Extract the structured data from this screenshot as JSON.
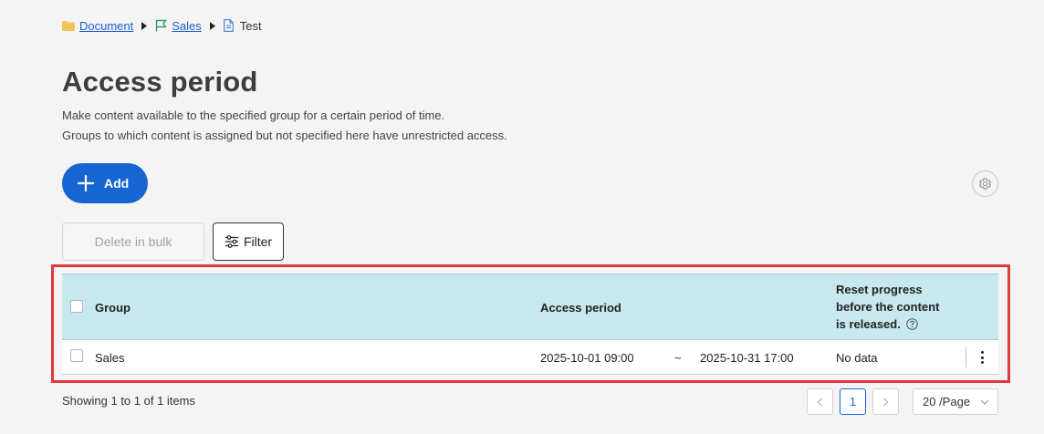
{
  "breadcrumb": {
    "items": [
      {
        "label": "Document",
        "icon": "folder-icon"
      },
      {
        "label": "Sales",
        "icon": "flag-icon"
      },
      {
        "label": "Test",
        "icon": "file-icon"
      }
    ]
  },
  "page": {
    "title": "Access period",
    "description_line1": "Make content available to the specified group for a certain period of time.",
    "description_line2": "Groups to which content is assigned but not specified here have unrestricted access."
  },
  "toolbar": {
    "add_label": "Add",
    "delete_bulk_label": "Delete in bulk",
    "filter_label": "Filter"
  },
  "table": {
    "headers": {
      "group": "Group",
      "access_period": "Access period",
      "reset_line1": "Reset progress",
      "reset_line2": "before the content",
      "reset_line3": "is released."
    },
    "rows": [
      {
        "group": "Sales",
        "start": "2025-10-01 09:00",
        "separator": "~",
        "end": "2025-10-31 17:00",
        "reset": "No data"
      }
    ]
  },
  "pagination": {
    "showing": "Showing 1 to 1 of 1 items",
    "current_page": "1",
    "prev": "<",
    "next": ">",
    "per_page": "20 /Page"
  },
  "colors": {
    "accent": "#1765d3",
    "table_header": "#c8e8f0",
    "highlight": "#e0393c",
    "link": "#1a5fc9"
  }
}
